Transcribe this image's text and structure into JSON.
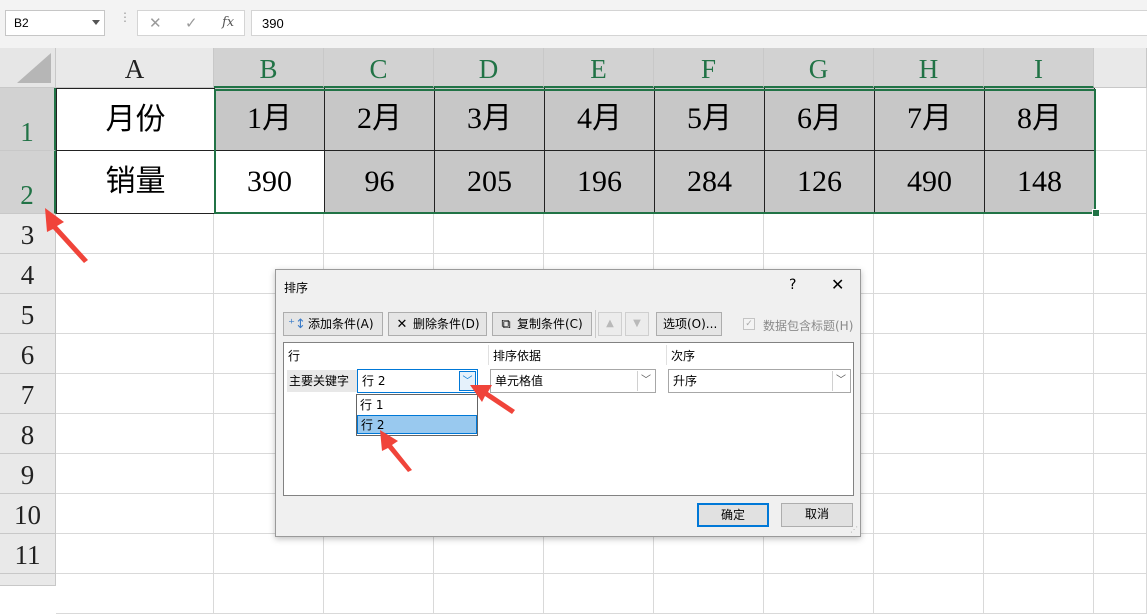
{
  "formula_bar": {
    "name_box": "B2",
    "formula_value": "390",
    "fx_label": "fx",
    "cancel_glyph": "✕",
    "enter_glyph": "✓",
    "dots": "⋮"
  },
  "columns": [
    "A",
    "B",
    "C",
    "D",
    "E",
    "F",
    "G",
    "H",
    "I"
  ],
  "rows": [
    "1",
    "2",
    "3",
    "4",
    "5",
    "6",
    "7",
    "8",
    "9",
    "10",
    "11"
  ],
  "table": {
    "row1_label": "月份",
    "row2_label": "销量",
    "months": [
      "1月",
      "2月",
      "3月",
      "4月",
      "5月",
      "6月",
      "7月",
      "8月"
    ],
    "sales": [
      "390",
      "96",
      "205",
      "196",
      "284",
      "126",
      "490",
      "148"
    ]
  },
  "dialog": {
    "title": "排序",
    "help": "?",
    "close": "✕",
    "toolbar": {
      "add": "添加条件(A)",
      "delete": "删除条件(D)",
      "copy": "复制条件(C)",
      "up": "▲",
      "down": "▼",
      "options": "选项(O)...",
      "header_checkbox": "数据包含标题(H)"
    },
    "columns": {
      "row": "行",
      "sort_on": "排序依据",
      "order": "次序"
    },
    "key_label": "主要关键字",
    "key_value": "行 2",
    "sort_on_value": "单元格值",
    "order_value": "升序",
    "dropdown_options": [
      "行 1",
      "行 2"
    ],
    "ok": "确定",
    "cancel": "取消"
  },
  "colors": {
    "excel_green": "#217346",
    "annotation_red": "#f0443a",
    "dropdown_highlight": "#99c9ef"
  }
}
